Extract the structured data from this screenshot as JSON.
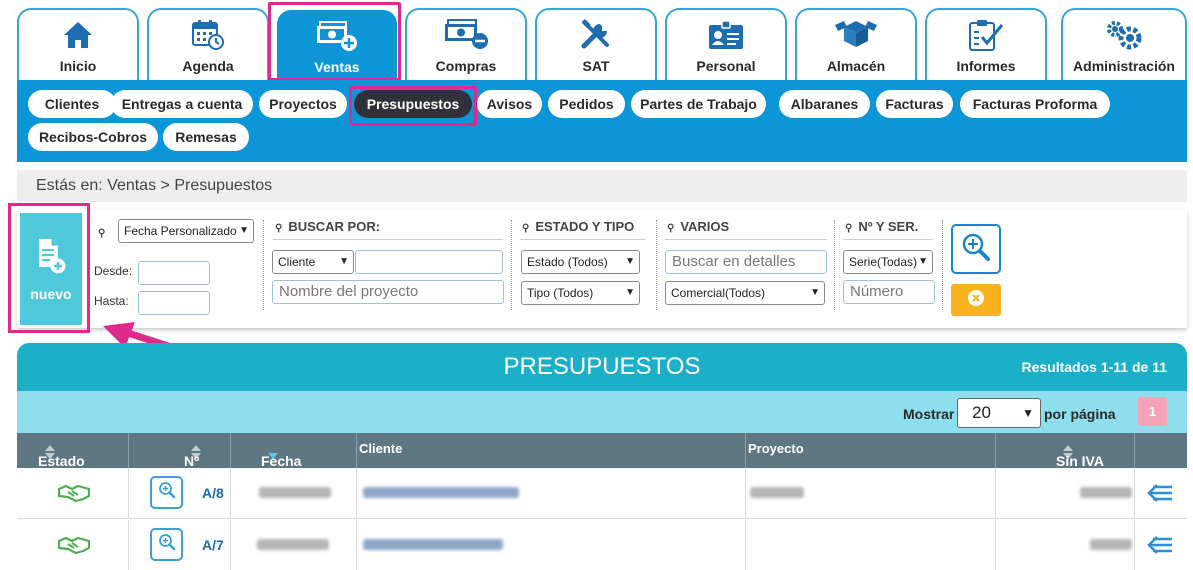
{
  "modules": [
    {
      "label": "Inicio",
      "icon": "home-icon"
    },
    {
      "label": "Agenda",
      "icon": "calendar-icon"
    },
    {
      "label": "Ventas",
      "icon": "money-plus-icon",
      "active": true
    },
    {
      "label": "Compras",
      "icon": "money-minus-icon"
    },
    {
      "label": "SAT",
      "icon": "tools-icon"
    },
    {
      "label": "Personal",
      "icon": "id-card-icon"
    },
    {
      "label": "Almacén",
      "icon": "boxes-icon"
    },
    {
      "label": "Informes",
      "icon": "clipboard-check-icon"
    },
    {
      "label": "Administración",
      "icon": "gears-icon"
    }
  ],
  "subnav": [
    "Clientes",
    "Entregas a cuenta",
    "Proyectos",
    "Presupuestos",
    "Avisos",
    "Pedidos",
    "Partes de Trabajo",
    "Albaranes",
    "Facturas",
    "Facturas Proforma",
    "Recibos-Cobros",
    "Remesas"
  ],
  "subnav_active": "Presupuestos",
  "breadcrumb": "Estás en: Ventas > Presupuestos",
  "nuevo_label": "nuevo",
  "filters": {
    "date_select": "Fecha Personalizado",
    "desde_label": "Desde:",
    "hasta_label": "Hasta:",
    "buscar_por_heading": "BUSCAR POR:",
    "cliente_select": "Cliente",
    "proyecto_placeholder": "Nombre del proyecto",
    "estado_tipo_heading": "ESTADO Y TIPO",
    "estado_select": "Estado (Todos)",
    "tipo_select": "Tipo (Todos)",
    "varios_heading": "VARIOS",
    "detalles_placeholder": "Buscar en detalles",
    "comercial_select": "Comercial(Todos)",
    "nyser_heading": "Nº Y SER.",
    "serie_select": "Serie(Todas)",
    "numero_placeholder": "Número"
  },
  "results": {
    "title": "PRESUPUESTOS",
    "count": "Resultados 1-11 de 11",
    "mostrar_label": "Mostrar",
    "per_page_value": "20",
    "per_page_label": "por página",
    "page": "1"
  },
  "table": {
    "columns": [
      "Estado",
      "Nº",
      "Fecha",
      "Cliente",
      "Proyecto",
      "Sin IVA"
    ],
    "rows": [
      {
        "numero": "A/8"
      },
      {
        "numero": "A/7"
      }
    ]
  },
  "colors": {
    "primary": "#0c96d8",
    "teal": "#1bafc8",
    "nuevo": "#4fc8dc",
    "highlight": "#e0298b",
    "header_dark": "#5f7783",
    "warning": "#f8b31f"
  }
}
